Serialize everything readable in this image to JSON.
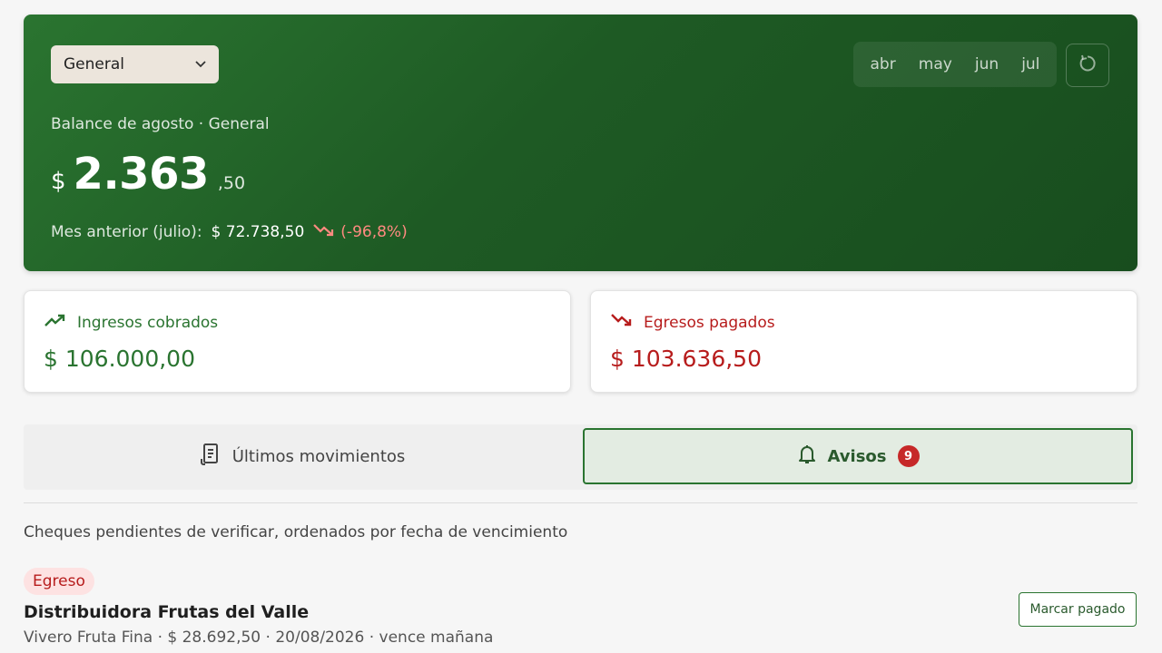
{
  "balance": {
    "account_select": "General",
    "months": [
      "abr",
      "may",
      "jun",
      "jul"
    ],
    "label": "Balance de agosto · General",
    "currency": "$",
    "amount_int": "2.363",
    "amount_dec": ",50",
    "prev_label": "Mes anterior (julio):",
    "prev_value": "$ 72.738,50",
    "prev_change": "(-96,8%)"
  },
  "cards": {
    "income_label": "Ingresos cobrados",
    "income_value": "$ 106.000,00",
    "expense_label": "Egresos pagados",
    "expense_value": "$ 103.636,50"
  },
  "tabs": {
    "movements": "Últimos movimientos",
    "alerts": "Avisos",
    "alerts_count": "9"
  },
  "alerts": {
    "description": "Cheques pendientes de verificar, ordenados por fecha de vencimiento",
    "items": [
      {
        "type": "Egreso",
        "title": "Distribuidora Frutas del Valle",
        "subtitle": "Vivero Fruta Fina · $ 28.692,50 · 20/08/2026 · vence mañana",
        "action": "Marcar pagado"
      }
    ]
  },
  "colors": {
    "primary": "#2a7430",
    "income": "#2a7430",
    "expense": "#b71c1c",
    "negative_change": "#ff8a80"
  },
  "icons": {
    "select": "chevron-down-icon",
    "refresh": "refresh-icon",
    "income": "trending-up-icon",
    "expense": "trending-down-icon",
    "movements": "receipt-icon",
    "alerts": "bell-icon"
  }
}
